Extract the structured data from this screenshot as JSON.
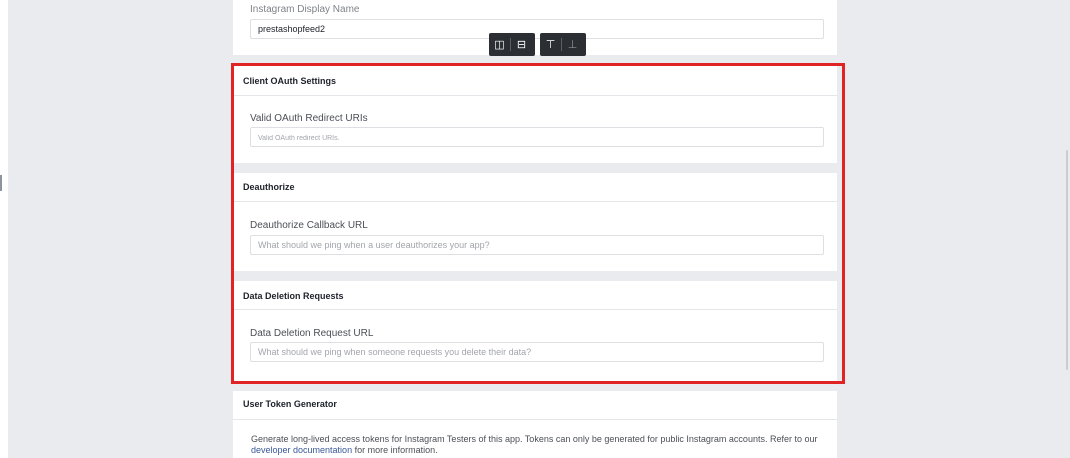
{
  "display_name": {
    "label": "Instagram Display Name",
    "value": "prestashopfeed2"
  },
  "client_oauth": {
    "title": "Client OAuth Settings",
    "field_label": "Valid OAuth Redirect URIs",
    "placeholder": "Valid OAuth redirect URIs."
  },
  "deauthorize": {
    "title": "Deauthorize",
    "field_label": "Deauthorize Callback URL",
    "placeholder": "What should we ping when a user deauthorizes your app?"
  },
  "data_deletion": {
    "title": "Data Deletion Requests",
    "field_label": "Data Deletion Request URL",
    "placeholder": "What should we ping when someone requests you delete their data?"
  },
  "user_token": {
    "title": "User Token Generator",
    "text_before_link": "Generate long-lived access tokens for Instagram Testers of this app. Tokens can only be generated for public Instagram accounts. Refer to our ",
    "link_text": "developer documentation",
    "text_after_link": " for more information."
  },
  "toolbar": {
    "buttons": [
      {
        "icon": "split-vertical-icon",
        "glyph": "◫"
      },
      {
        "icon": "split-horizontal-icon",
        "glyph": "⊟"
      },
      {
        "icon": "insert-row-icon",
        "glyph": "⊤"
      },
      {
        "icon": "align-bottom-icon",
        "glyph": "⊥"
      }
    ]
  },
  "colors": {
    "background": "#e9ebee",
    "panel": "#ffffff",
    "highlight_border": "#e02424",
    "link": "#385898"
  }
}
